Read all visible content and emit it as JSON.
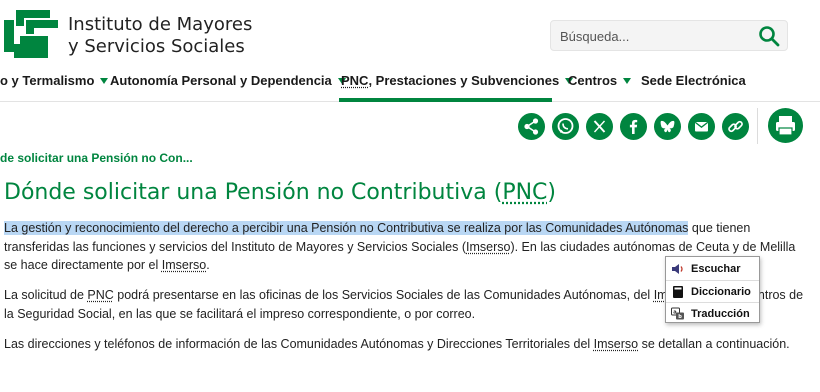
{
  "header": {
    "brand_line1": "Instituto de Mayores",
    "brand_line2": "y Servicios Sociales",
    "search_placeholder": "Búsqueda...",
    "brand_color": "#00853f"
  },
  "nav": {
    "items": [
      {
        "label": "o y Termalismo",
        "has_caret": true
      },
      {
        "label": "Autonomía Personal y Dependencia",
        "has_caret": true
      },
      {
        "label_prefix": "PNC",
        "label": ", Prestaciones y Subvenciones",
        "has_caret": true,
        "active": true
      },
      {
        "label": "Centros",
        "has_caret": true
      },
      {
        "label": "Sede Electrónica",
        "has_caret": false
      }
    ]
  },
  "share_icons": [
    "share-icon",
    "whatsapp-icon",
    "x-icon",
    "facebook-icon",
    "bluesky-icon",
    "email-icon",
    "link-icon",
    "print-icon"
  ],
  "breadcrumb": "de solicitar una Pensión no Con...",
  "title": {
    "prefix": "Dónde solicitar una Pensión no Contributiva (",
    "abbr": "PNC",
    "suffix": ")"
  },
  "paragraphs": {
    "p1_highlighted": "La gestión y reconocimiento del derecho a percibir una Pensión no Contributiva se realiza por las Comunidades Autónomas",
    "p1_rest_a": " que tienen transferidas las funciones y servicios del Instituto de Mayores y Servicios Sociales (",
    "p1_abbr1": "Imserso",
    "p1_rest_b": "). En las ciudades autónomas de Ceuta y de Melilla se hace directamente por el ",
    "p1_abbr2": "Imserso",
    "p1_end": ".",
    "p2_a": "La solicitud de ",
    "p2_abbr1": "PNC",
    "p2_b": " podrá presentarse en las oficinas de los Servicios Sociales de las Comunidades Autónomas, del ",
    "p2_abbr2": "Imserso",
    "p2_c": ", en los Centros de la Seguridad Social, en las que se facilitará el impreso correspondiente, o por correo.",
    "p3_a": "Las direcciones y teléfonos de información de las Comunidades Autónomas y Direcciones Territoriales del ",
    "p3_abbr": "Imserso",
    "p3_b": " se detallan a continuación."
  },
  "popup": {
    "items": [
      {
        "label": "Escuchar",
        "icon": "speaker-icon"
      },
      {
        "label": "Diccionario",
        "icon": "dictionary-icon"
      },
      {
        "label": "Traducción",
        "icon": "translate-icon"
      }
    ]
  }
}
